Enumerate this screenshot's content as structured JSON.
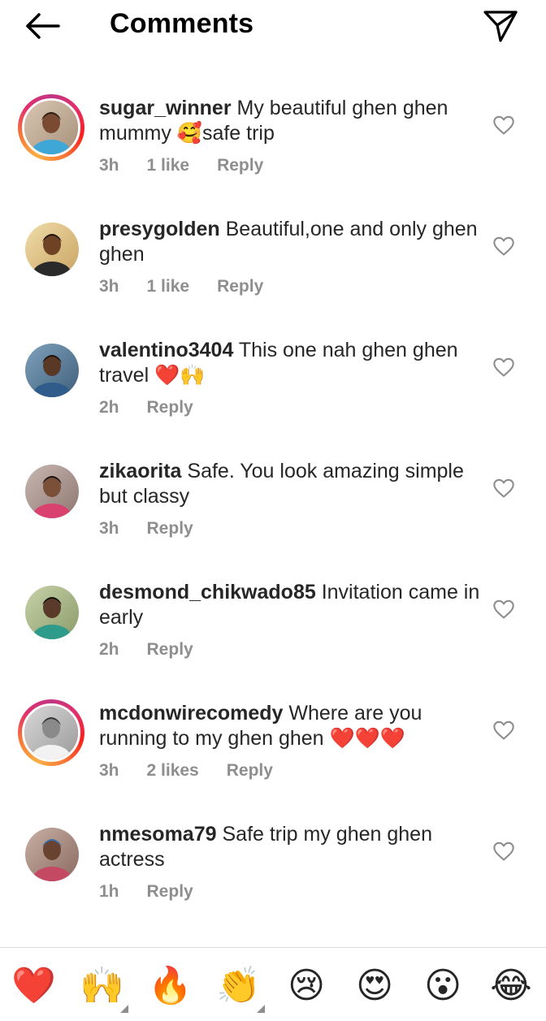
{
  "header": {
    "title": "Comments",
    "back_icon": "arrow-left-icon",
    "send_icon": "paper-plane-icon"
  },
  "comments": [
    {
      "username": "sugar_winner",
      "text": "My beautiful ghen ghen mummy 🥰safe trip",
      "time": "3h",
      "likes": "1 like",
      "reply": "Reply",
      "story_ring": true
    },
    {
      "username": "presygolden",
      "text": "Beautiful,one and only ghen ghen",
      "time": "3h",
      "likes": "1 like",
      "reply": "Reply",
      "story_ring": false
    },
    {
      "username": "valentino3404",
      "text": "This one nah ghen ghen travel ❤️🙌",
      "time": "2h",
      "likes": "",
      "reply": "Reply",
      "story_ring": false
    },
    {
      "username": "zikaorita",
      "text": "Safe. You look amazing simple but classy",
      "time": "3h",
      "likes": "",
      "reply": "Reply",
      "story_ring": false
    },
    {
      "username": "desmond_chikwado85",
      "text": "Invitation came in early",
      "time": "2h",
      "likes": "",
      "reply": "Reply",
      "story_ring": false
    },
    {
      "username": "mcdonwirecomedy",
      "text": "Where are you running to my ghen ghen ❤️❤️❤️",
      "time": "3h",
      "likes": "2 likes",
      "reply": "Reply",
      "story_ring": true
    },
    {
      "username": "nmesoma79",
      "text": "Safe trip my ghen ghen actress",
      "time": "1h",
      "likes": "",
      "reply": "Reply",
      "story_ring": false
    }
  ],
  "emoji_bar": [
    {
      "emoji": "❤️",
      "name": "red-heart-emoji",
      "has_variants": false
    },
    {
      "emoji": "🙌",
      "name": "raising-hands-emoji",
      "has_variants": true
    },
    {
      "emoji": "🔥",
      "name": "fire-emoji",
      "has_variants": false
    },
    {
      "emoji": "👏",
      "name": "clapping-hands-emoji",
      "has_variants": true
    },
    {
      "emoji": "😢",
      "name": "crying-face-emoji",
      "has_variants": false
    },
    {
      "emoji": "😍",
      "name": "heart-eyes-emoji",
      "has_variants": false
    },
    {
      "emoji": "😮",
      "name": "surprised-face-emoji",
      "has_variants": false
    },
    {
      "emoji": "😂",
      "name": "tears-of-joy-emoji",
      "has_variants": false
    }
  ],
  "colors": {
    "text": "#262626",
    "meta": "#8e8e8e",
    "divider": "#dbdbdb",
    "story_ring": "#e1306c"
  }
}
